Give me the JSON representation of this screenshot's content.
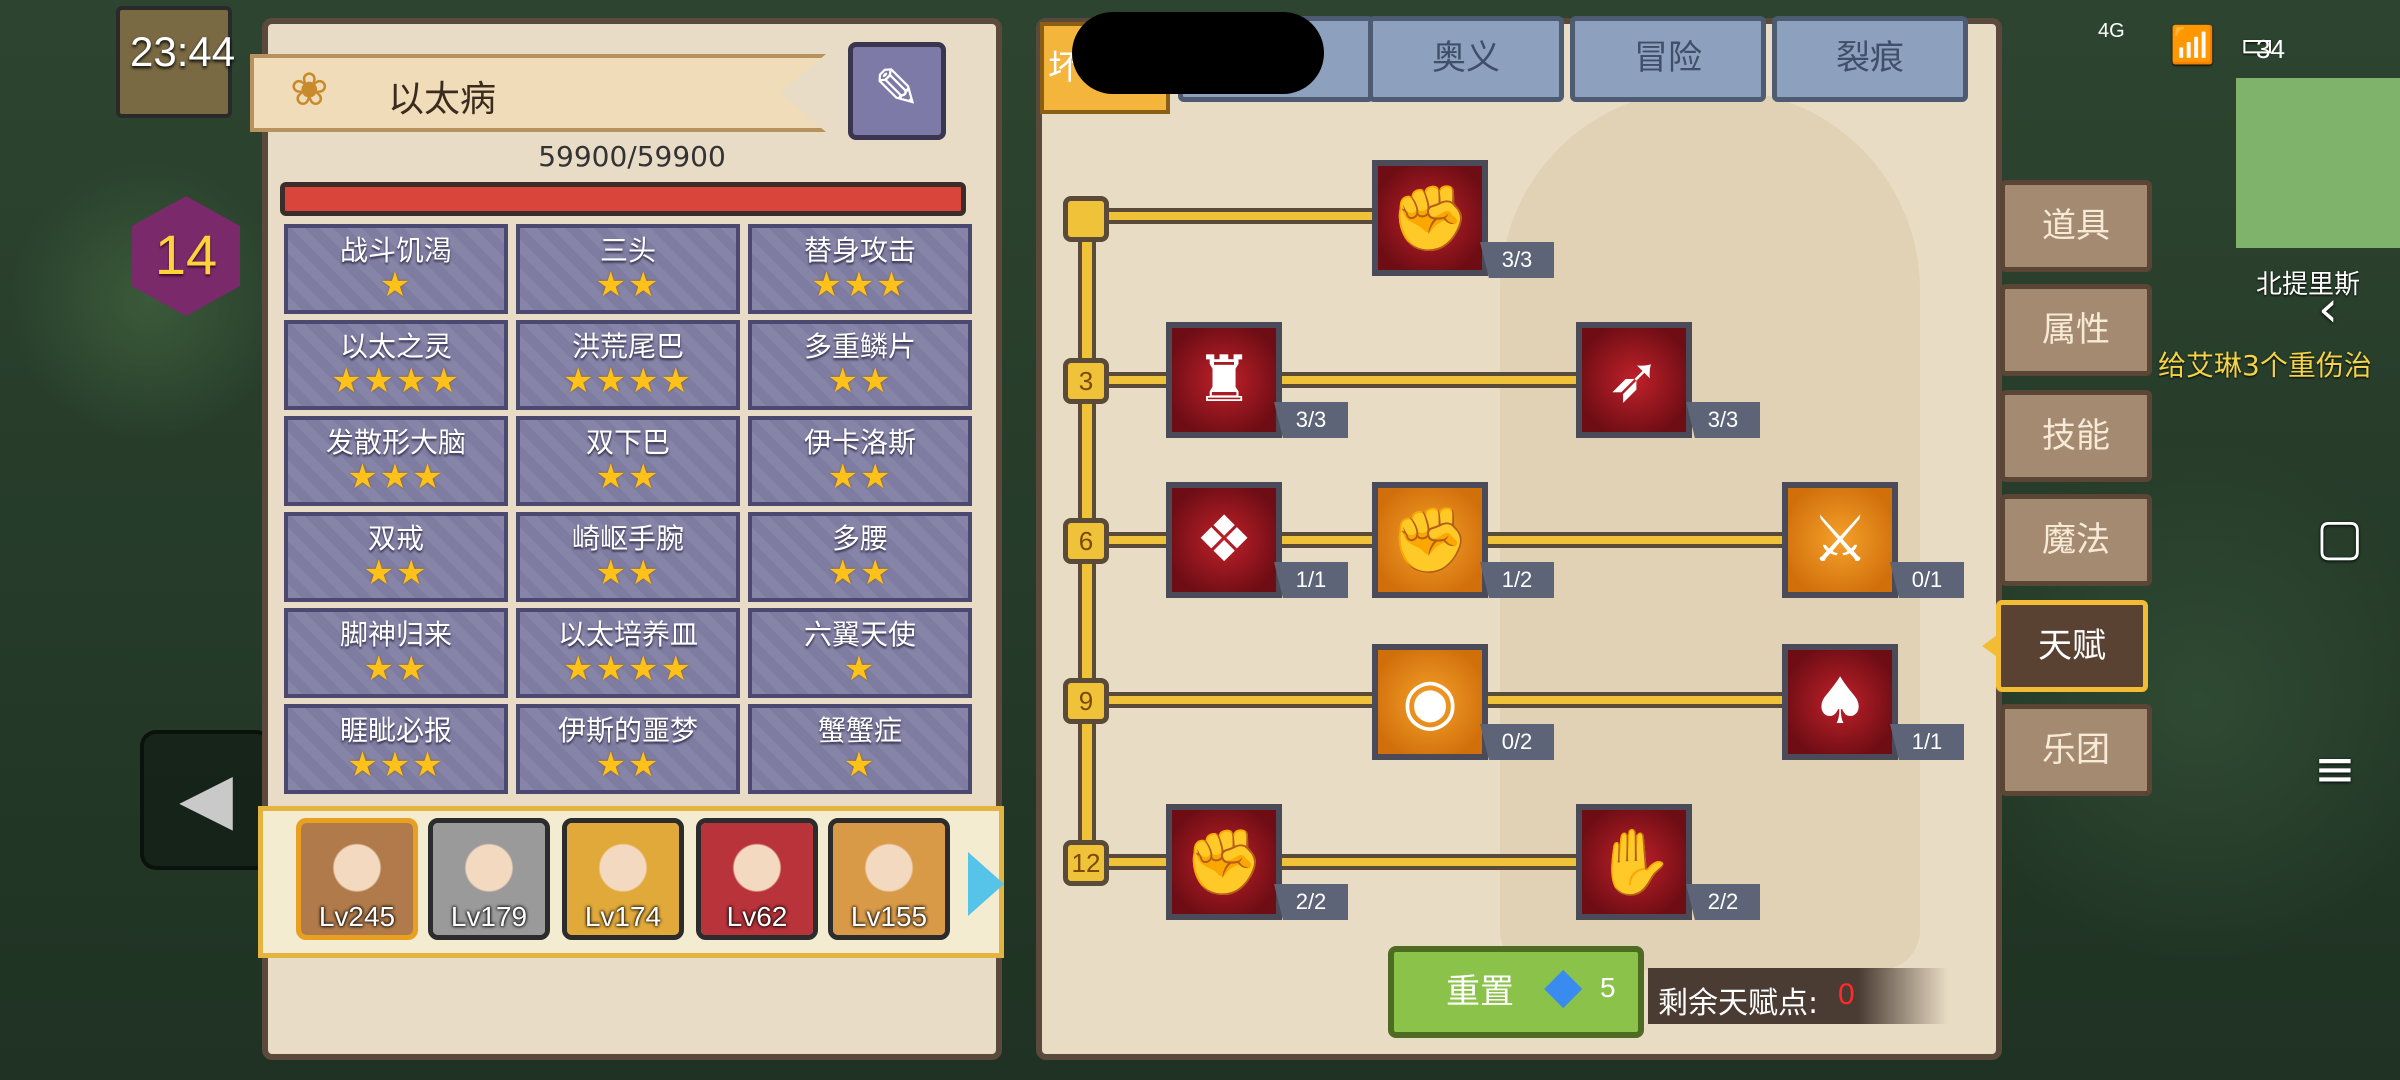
{
  "status": {
    "time": "23:44",
    "battery": "34",
    "network": "4G"
  },
  "hud": {
    "player_level": "14",
    "map_name": "北提里斯",
    "quest_text": "给艾琳3个重伤治"
  },
  "character": {
    "name": "以太病",
    "hp": "59900/59900",
    "traits": [
      {
        "name": "战斗饥渴",
        "stars": "★"
      },
      {
        "name": "三头",
        "stars": "★★"
      },
      {
        "name": "替身攻击",
        "stars": "★★★"
      },
      {
        "name": "以太之灵",
        "stars": "★★★★"
      },
      {
        "name": "洪荒尾巴",
        "stars": "★★★★"
      },
      {
        "name": "多重鳞片",
        "stars": "★★"
      },
      {
        "name": "发散形大脑",
        "stars": "★★★"
      },
      {
        "name": "双下巴",
        "stars": "★★"
      },
      {
        "name": "伊卡洛斯",
        "stars": "★★"
      },
      {
        "name": "双戒",
        "stars": "★★"
      },
      {
        "name": "崎岖手腕",
        "stars": "★★"
      },
      {
        "name": "多腰",
        "stars": "★★"
      },
      {
        "name": "脚神归来",
        "stars": "★★"
      },
      {
        "name": "以太培养皿",
        "stars": "★★★★"
      },
      {
        "name": "六翼天使",
        "stars": "★"
      },
      {
        "name": "睚眦必报",
        "stars": "★★★"
      },
      {
        "name": "伊斯的噩梦",
        "stars": "★★"
      },
      {
        "name": "蟹蟹症",
        "stars": "★"
      }
    ]
  },
  "party": [
    {
      "level": "Lv245",
      "color": "#b07a4a"
    },
    {
      "level": "Lv179",
      "color": "#9a9a9a"
    },
    {
      "level": "Lv174",
      "color": "#e0a93a"
    },
    {
      "level": "Lv62",
      "color": "#b8333a"
    },
    {
      "level": "Lv155",
      "color": "#d99a48"
    }
  ],
  "top_tabs": {
    "active": "坏",
    "t2": "奥义",
    "t3": "冒险",
    "t4": "裂痕"
  },
  "talents": {
    "row_levels": [
      "3",
      "6",
      "9",
      "12"
    ],
    "skills": [
      {
        "id": "arm-wrestle",
        "icon": "✊",
        "color": "red",
        "progress": "3/3"
      },
      {
        "id": "muscle-body",
        "icon": "♜",
        "color": "red",
        "progress": "3/3"
      },
      {
        "id": "arrow-strike",
        "icon": "➶",
        "color": "red",
        "progress": "3/3"
      },
      {
        "id": "card-dash",
        "icon": "❖",
        "color": "red",
        "progress": "1/1"
      },
      {
        "id": "punch",
        "icon": "✊",
        "color": "orange",
        "progress": "1/2"
      },
      {
        "id": "blade-slash",
        "icon": "⚔",
        "color": "orange",
        "progress": "0/1"
      },
      {
        "id": "ripple",
        "icon": "◉",
        "color": "orange",
        "progress": "0/2"
      },
      {
        "id": "demon-wings",
        "icon": "♠",
        "color": "red",
        "progress": "1/1"
      },
      {
        "id": "fist",
        "icon": "✊",
        "color": "red",
        "progress": "2/2"
      },
      {
        "id": "fist-slash",
        "icon": "✋",
        "color": "red",
        "progress": "2/2"
      }
    ],
    "reset_label": "重置",
    "reset_cost": "5",
    "points_label": "剩余天赋点:",
    "points_value": "0"
  },
  "menu": [
    "道具",
    "属性",
    "技能",
    "魔法",
    "天赋",
    "乐团"
  ],
  "menu_active_index": 4
}
